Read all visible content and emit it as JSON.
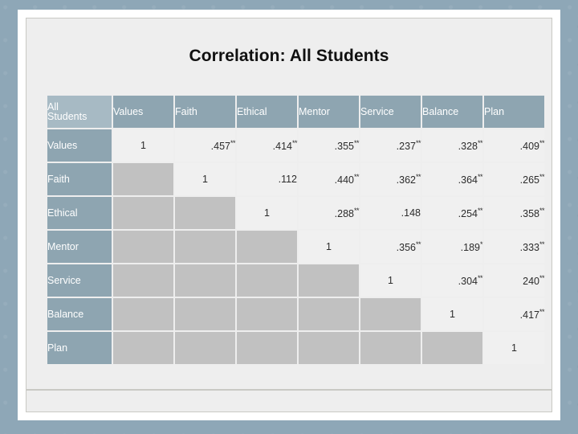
{
  "slide": {
    "title": "Correlation: All Students",
    "background_color": "#8ea7b7",
    "panel_color": "#eeeeee",
    "header_color": "#8ea5b1",
    "corner_color": "#a7bac4",
    "cell_color": "#f0f0f0",
    "blank_color": "#c1c1c1"
  },
  "table": {
    "corner_label_line1": "All",
    "corner_label_line2": "Students",
    "columns": [
      "Values",
      "Faith",
      "Ethical",
      "Mentor",
      "Service",
      "Balance",
      "Plan"
    ],
    "rows": [
      {
        "label": "Values",
        "cells": [
          {
            "text": "1",
            "sup": "",
            "type": "diag"
          },
          {
            "text": ".457",
            "sup": "**",
            "type": "value"
          },
          {
            "text": ".414",
            "sup": "**",
            "type": "value"
          },
          {
            "text": ".355",
            "sup": "**",
            "type": "value"
          },
          {
            "text": ".237",
            "sup": "**",
            "type": "value"
          },
          {
            "text": ".328",
            "sup": "**",
            "type": "value"
          },
          {
            "text": ".409",
            "sup": "**",
            "type": "value"
          }
        ]
      },
      {
        "label": "Faith",
        "cells": [
          {
            "text": "",
            "sup": "",
            "type": "blank"
          },
          {
            "text": "1",
            "sup": "",
            "type": "diag"
          },
          {
            "text": ".112",
            "sup": "",
            "type": "value"
          },
          {
            "text": ".440",
            "sup": "**",
            "type": "value"
          },
          {
            "text": ".362",
            "sup": "**",
            "type": "value"
          },
          {
            "text": ".364",
            "sup": "**",
            "type": "value"
          },
          {
            "text": ".265",
            "sup": "**",
            "type": "value"
          }
        ]
      },
      {
        "label": "Ethical",
        "cells": [
          {
            "text": "",
            "sup": "",
            "type": "blank"
          },
          {
            "text": "",
            "sup": "",
            "type": "blank"
          },
          {
            "text": "1",
            "sup": "",
            "type": "diag"
          },
          {
            "text": ".288",
            "sup": "**",
            "type": "value"
          },
          {
            "text": ".148",
            "sup": "",
            "type": "value"
          },
          {
            "text": ".254",
            "sup": "**",
            "type": "value"
          },
          {
            "text": ".358",
            "sup": "**",
            "type": "value"
          }
        ]
      },
      {
        "label": "Mentor",
        "cells": [
          {
            "text": "",
            "sup": "",
            "type": "blank"
          },
          {
            "text": "",
            "sup": "",
            "type": "blank"
          },
          {
            "text": "",
            "sup": "",
            "type": "blank"
          },
          {
            "text": "1",
            "sup": "",
            "type": "diag"
          },
          {
            "text": ".356",
            "sup": "**",
            "type": "value"
          },
          {
            "text": ".189",
            "sup": "*",
            "type": "value"
          },
          {
            "text": ".333",
            "sup": "**",
            "type": "value"
          }
        ]
      },
      {
        "label": "Service",
        "cells": [
          {
            "text": "",
            "sup": "",
            "type": "blank"
          },
          {
            "text": "",
            "sup": "",
            "type": "blank"
          },
          {
            "text": "",
            "sup": "",
            "type": "blank"
          },
          {
            "text": "",
            "sup": "",
            "type": "blank"
          },
          {
            "text": "1",
            "sup": "",
            "type": "diag"
          },
          {
            "text": ".304",
            "sup": "**",
            "type": "value"
          },
          {
            "text": "240",
            "sup": "**",
            "type": "value"
          }
        ]
      },
      {
        "label": "Balance",
        "cells": [
          {
            "text": "",
            "sup": "",
            "type": "blank"
          },
          {
            "text": "",
            "sup": "",
            "type": "blank"
          },
          {
            "text": "",
            "sup": "",
            "type": "blank"
          },
          {
            "text": "",
            "sup": "",
            "type": "blank"
          },
          {
            "text": "",
            "sup": "",
            "type": "blank"
          },
          {
            "text": "1",
            "sup": "",
            "type": "diag"
          },
          {
            "text": ".417",
            "sup": "**",
            "type": "value"
          }
        ]
      },
      {
        "label": "Plan",
        "cells": [
          {
            "text": "",
            "sup": "",
            "type": "blank"
          },
          {
            "text": "",
            "sup": "",
            "type": "blank"
          },
          {
            "text": "",
            "sup": "",
            "type": "blank"
          },
          {
            "text": "",
            "sup": "",
            "type": "blank"
          },
          {
            "text": "",
            "sup": "",
            "type": "blank"
          },
          {
            "text": "",
            "sup": "",
            "type": "blank"
          },
          {
            "text": "1",
            "sup": "",
            "type": "diag"
          }
        ]
      }
    ]
  }
}
